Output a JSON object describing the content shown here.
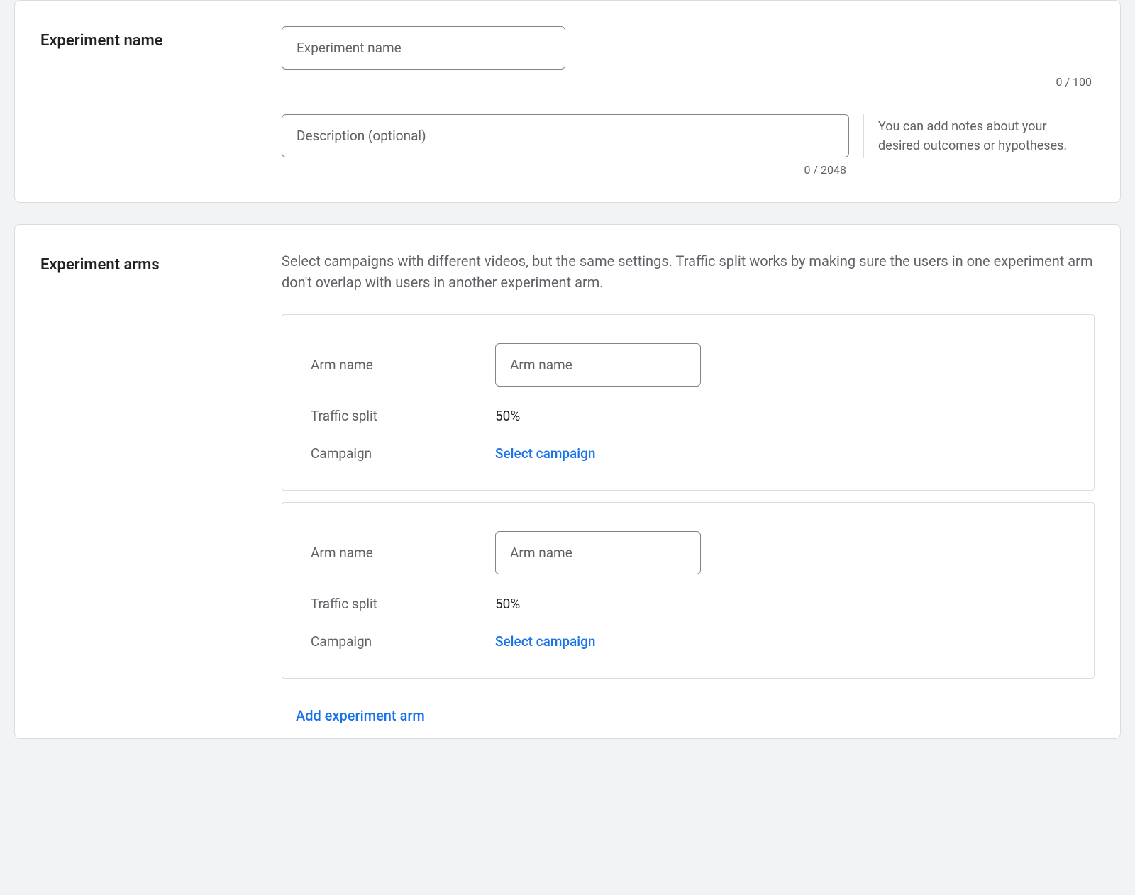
{
  "name_section": {
    "label": "Experiment name",
    "name_placeholder": "Experiment name",
    "name_counter": "0 / 100",
    "desc_placeholder": "Description (optional)",
    "desc_counter": "0 / 2048",
    "desc_helper": "You can add notes about your desired outcomes or hypotheses."
  },
  "arms_section": {
    "label": "Experiment arms",
    "intro": "Select campaigns with different videos, but the same settings. Traffic split works by making sure the users in one experiment arm don't overlap with users in another experiment arm.",
    "arm_name_label": "Arm name",
    "arm_name_placeholder": "Arm name",
    "traffic_split_label": "Traffic split",
    "campaign_label": "Campaign",
    "select_campaign": "Select campaign",
    "add_arm": "Add experiment arm",
    "arms": [
      {
        "traffic_split": "50%"
      },
      {
        "traffic_split": "50%"
      }
    ]
  }
}
